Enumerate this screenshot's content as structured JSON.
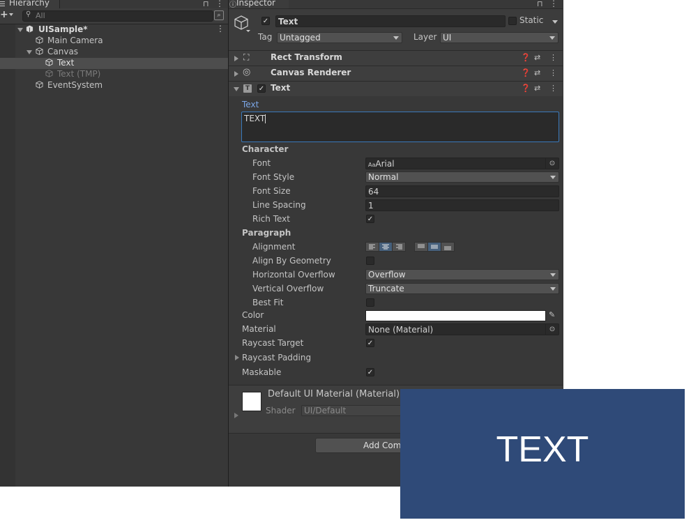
{
  "hierarchy": {
    "tab_label": "Hierarchy",
    "search_placeholder": "All",
    "items": [
      {
        "label": "UISample*"
      },
      {
        "label": "Main Camera"
      },
      {
        "label": "Canvas"
      },
      {
        "label": "Text"
      },
      {
        "label": "Text (TMP)"
      },
      {
        "label": "EventSystem"
      }
    ]
  },
  "inspector": {
    "tab_label": "Inspector",
    "object_name": "Text",
    "static_label": "Static",
    "tag_label": "Tag",
    "tag_value": "Untagged",
    "layer_label": "Layer",
    "layer_value": "UI",
    "components": [
      {
        "name": "Rect Transform"
      },
      {
        "name": "Canvas Renderer"
      },
      {
        "name": "Text"
      }
    ],
    "text_component": {
      "text_label": "Text",
      "text_value": "TEXT",
      "character_header": "Character",
      "font_label": "Font",
      "font_value": "Arial",
      "font_icon_text": "Aa",
      "font_style_label": "Font Style",
      "font_style_value": "Normal",
      "font_size_label": "Font Size",
      "font_size_value": "64",
      "line_spacing_label": "Line Spacing",
      "line_spacing_value": "1",
      "rich_text_label": "Rich Text",
      "paragraph_header": "Paragraph",
      "alignment_label": "Alignment",
      "align_by_geometry_label": "Align By Geometry",
      "h_overflow_label": "Horizontal Overflow",
      "h_overflow_value": "Overflow",
      "v_overflow_label": "Vertical Overflow",
      "v_overflow_value": "Truncate",
      "best_fit_label": "Best Fit",
      "color_label": "Color",
      "color_value": "#ffffff",
      "material_label": "Material",
      "material_value": "None (Material)",
      "raycast_target_label": "Raycast Target",
      "raycast_padding_label": "Raycast Padding",
      "maskable_label": "Maskable"
    },
    "material_preview": {
      "name": "Default UI Material (Material)",
      "shader_label": "Shader",
      "shader_value": "UI/Default"
    },
    "add_component_label": "Add Comp"
  },
  "game_view": {
    "text": "TEXT",
    "background_color": "#2f4a78"
  }
}
